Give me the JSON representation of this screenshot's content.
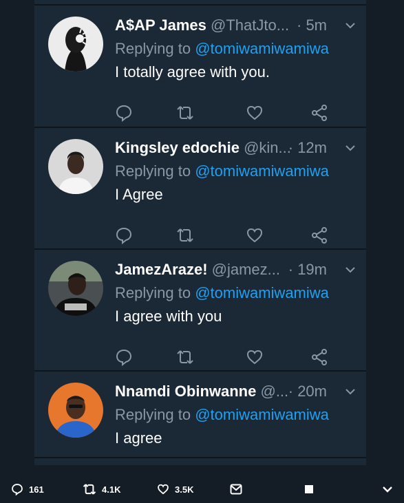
{
  "replies": [
    {
      "name": "A$AP James",
      "handle": "@ThatJto...",
      "time": "· 5m",
      "replying_label": "Replying to",
      "replying_to": "@tomiwamiwamiwa",
      "text": "I totally agree with you."
    },
    {
      "name": "Kingsley edochie",
      "handle": "@kin...",
      "time": "· 12m",
      "replying_label": "Replying to",
      "replying_to": "@tomiwamiwamiwa",
      "text": "I Agree"
    },
    {
      "name": "JamezAraze!",
      "handle": "@jamez...",
      "time": "· 19m",
      "replying_label": "Replying to",
      "replying_to": "@tomiwamiwamiwa",
      "text": "I agree with you"
    },
    {
      "name": "Nnamdi Obinwanne",
      "handle": "@...",
      "time": "· 20m",
      "replying_label": "Replying to",
      "replying_to": "@tomiwamiwamiwa",
      "text": "I agree"
    }
  ],
  "bottom_bar": {
    "replies_count": "161",
    "retweets_count": "4.1K",
    "likes_count": "3.5K"
  },
  "colors": {
    "background": "#141d26",
    "card": "#1b2836",
    "muted_text": "#8899a6",
    "link": "#1da1f2"
  }
}
